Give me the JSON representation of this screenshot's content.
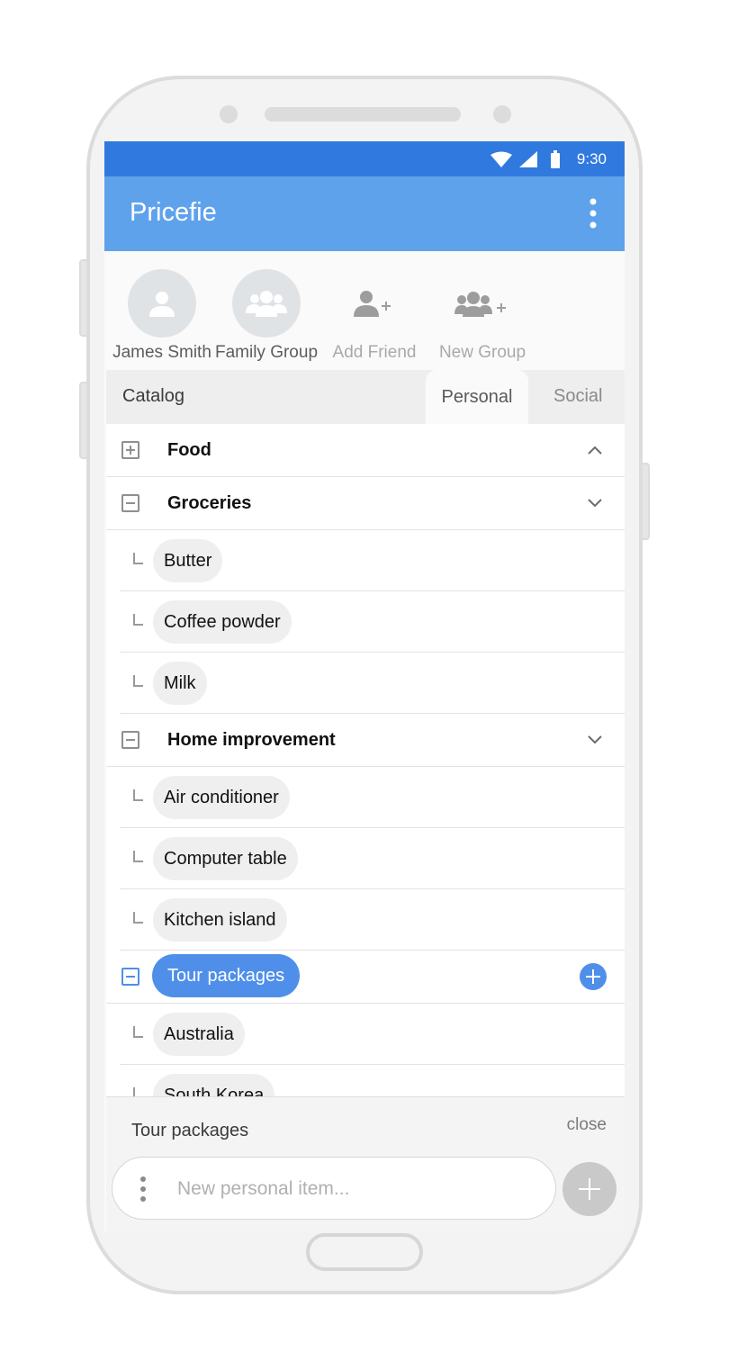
{
  "statusbar": {
    "time": "9:30"
  },
  "appbar": {
    "title": "Pricefie"
  },
  "contacts": [
    {
      "label": "James Smith",
      "icon": "person-icon",
      "muted": false
    },
    {
      "label": "Family Group",
      "icon": "group-icon",
      "muted": false
    },
    {
      "label": "Add Friend",
      "icon": "add-person-icon",
      "muted": true
    },
    {
      "label": "New Group",
      "icon": "add-group-icon",
      "muted": true
    }
  ],
  "tabs": {
    "catalog": "Catalog",
    "personal": "Personal",
    "social": "Social"
  },
  "list": {
    "food": "Food",
    "groceries": {
      "label": "Groceries",
      "items": [
        "Butter",
        "Coffee powder",
        "Milk"
      ]
    },
    "home": {
      "label": "Home improvement",
      "items": [
        "Air conditioner",
        "Computer table",
        "Kitchen island"
      ]
    },
    "tour": {
      "label": "Tour packages",
      "items": [
        "Australia",
        "South Korea"
      ]
    }
  },
  "bottom": {
    "title": "Tour packages",
    "close": "close",
    "input_placeholder": "New personal item..."
  },
  "colors": {
    "statusbar": "#3079de",
    "appbar": "#5fa2ec",
    "accent": "#4f8fea"
  }
}
